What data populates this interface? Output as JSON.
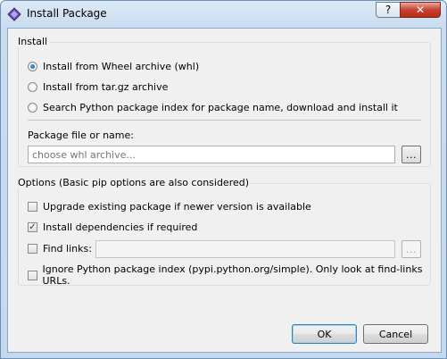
{
  "window": {
    "title": "Install Package",
    "help_label": "?",
    "close_label": "✕"
  },
  "install_group": {
    "title": "Install",
    "options": [
      {
        "label": "Install from Wheel archive (whl)",
        "selected": true
      },
      {
        "label": "Install from tar.gz archive",
        "selected": false
      },
      {
        "label": "Search Python package index for package name, download and install it",
        "selected": false
      }
    ],
    "package_label": "Package file or name:",
    "package_input": {
      "value": "",
      "placeholder": "choose whl archive..."
    },
    "browse_label": "..."
  },
  "options_group": {
    "title": "Options (Basic pip options are also considered)",
    "upgrade_label": "Upgrade existing package if newer version is available",
    "upgrade_checked": false,
    "deps_label": "Install dependencies if required",
    "deps_checked": true,
    "find_links_label": "Find links:",
    "find_links_checked": false,
    "find_links_value": "",
    "find_links_browse": "...",
    "ignore_index_label": "Ignore Python package index (pypi.python.org/simple). Only look at find-links URLs.",
    "ignore_index_checked": false
  },
  "buttons": {
    "ok": "OK",
    "cancel": "Cancel"
  },
  "colors": {
    "close_button": "#c7422f",
    "default_button_border": "#3c7fb1"
  }
}
